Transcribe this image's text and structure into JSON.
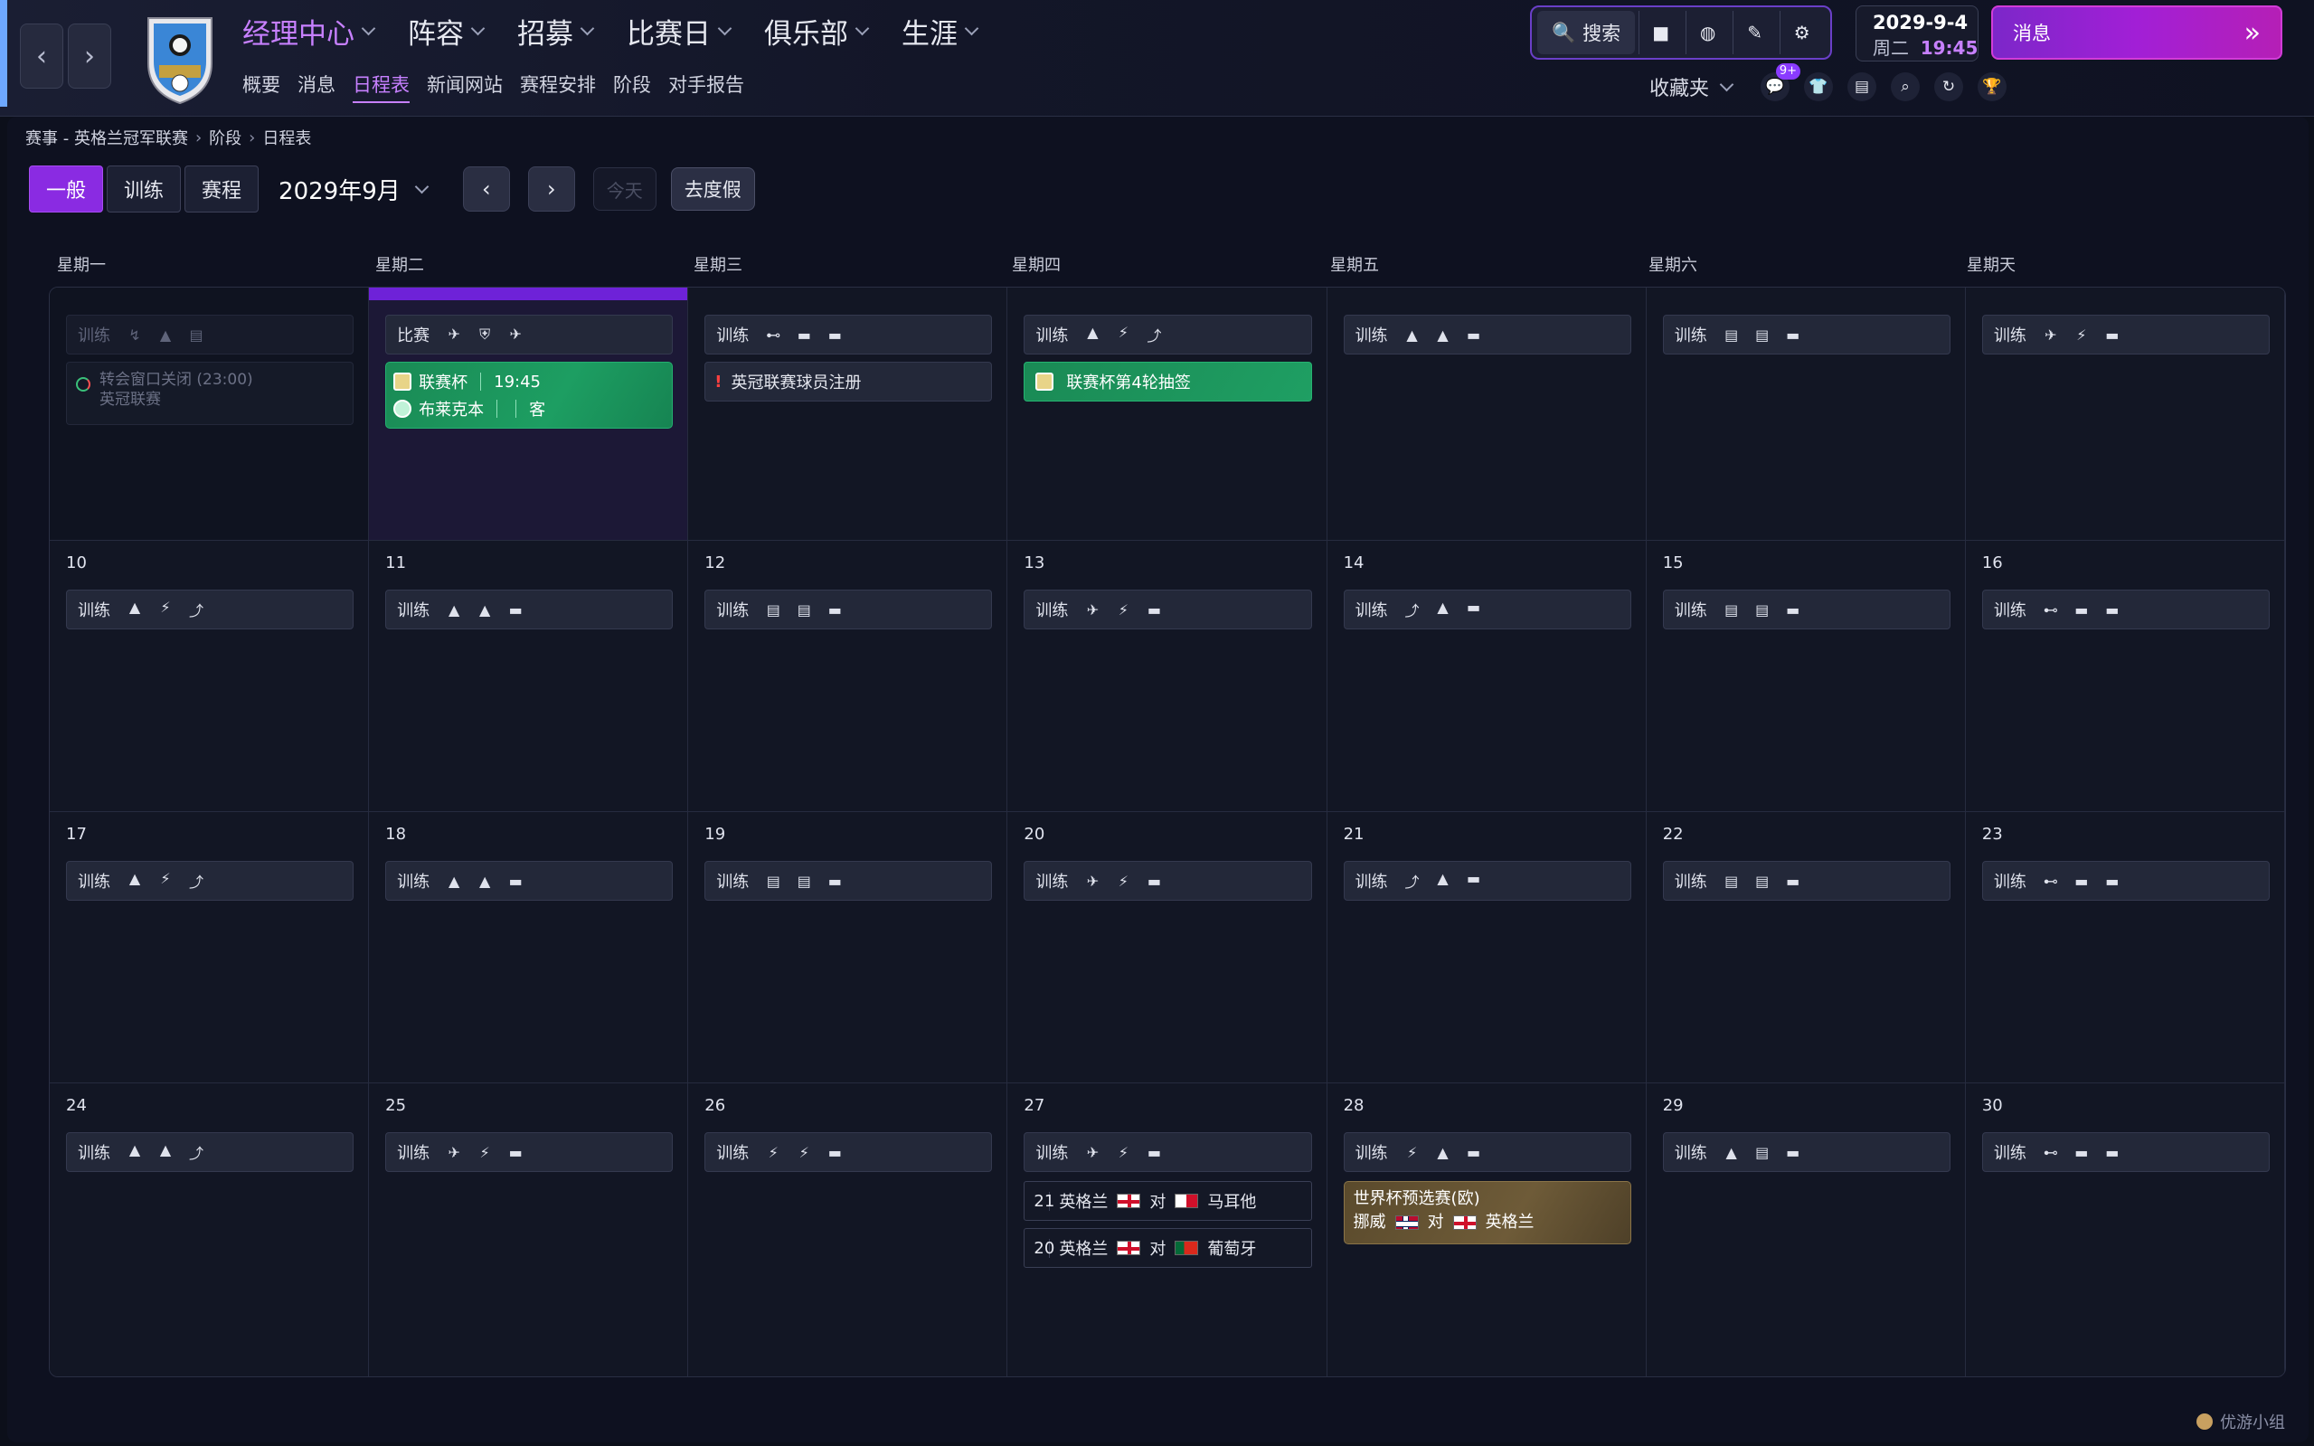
{
  "nav": {
    "back_icon": "‹",
    "forward_icon": "›"
  },
  "menu": [
    {
      "label": "经理中心",
      "active": true
    },
    {
      "label": "阵容"
    },
    {
      "label": "招募"
    },
    {
      "label": "比赛日"
    },
    {
      "label": "俱乐部"
    },
    {
      "label": "生涯"
    }
  ],
  "submenu": [
    {
      "label": "概要"
    },
    {
      "label": "消息"
    },
    {
      "label": "日程表",
      "active": true
    },
    {
      "label": "新闻网站"
    },
    {
      "label": "赛程安排"
    },
    {
      "label": "阶段"
    },
    {
      "label": "对手报告"
    }
  ],
  "tools": {
    "search_label": "搜索"
  },
  "datetime": {
    "date": "2029-9-4",
    "weekday": "周二",
    "time": "19:45"
  },
  "messages": {
    "label": "消息"
  },
  "favorites": {
    "label": "收藏夹",
    "badge": "9+"
  },
  "breadcrumb": {
    "part1": "赛事 - 英格兰冠军联赛",
    "part2": "阶段",
    "part3": "日程表"
  },
  "toolbar": {
    "view_general": "一般",
    "view_training": "训练",
    "view_fixtures": "赛程",
    "month": "2029年9月",
    "today": "今天",
    "vacation": "去度假"
  },
  "weekdays": [
    "星期一",
    "星期二",
    "星期三",
    "星期四",
    "星期五",
    "星期六",
    "星期天"
  ],
  "calendar": {
    "training_label": "训练",
    "match_label": "比赛",
    "days": [
      {
        "num": "10"
      },
      {
        "num": "11"
      },
      {
        "num": "12"
      },
      {
        "num": "13"
      },
      {
        "num": "14"
      },
      {
        "num": "15"
      },
      {
        "num": "16"
      },
      {
        "num": "17"
      },
      {
        "num": "18"
      },
      {
        "num": "19"
      },
      {
        "num": "20"
      },
      {
        "num": "21"
      },
      {
        "num": "22"
      },
      {
        "num": "23"
      },
      {
        "num": "24"
      },
      {
        "num": "25"
      },
      {
        "num": "26"
      },
      {
        "num": "27"
      },
      {
        "num": "28"
      },
      {
        "num": "29"
      },
      {
        "num": "30"
      }
    ]
  },
  "events": {
    "transfer_window": "转会窗口关闭 (23:00)",
    "transfer_league": "英冠联赛",
    "cup_match_comp": "联赛杯",
    "cup_match_time": "19:45",
    "cup_match_opponent": "布莱克本",
    "cup_match_venue": "客",
    "registration": "英冠联赛球员注册",
    "cup_draw": "联赛杯第4轮抽签",
    "intl1": {
      "num": "21",
      "home": "英格兰",
      "vs": "对",
      "away": "马耳他"
    },
    "intl2": {
      "num": "20",
      "home": "英格兰",
      "vs": "对",
      "away": "葡萄牙"
    },
    "wcq": {
      "title": "世界杯预选赛(欧)",
      "home": "挪威",
      "vs": "对",
      "away": "英格兰"
    }
  },
  "watermark": "优游小组",
  "colors": {
    "accent": "#c780ff",
    "primary": "#8a2be2",
    "match_green": "#1d9e62"
  }
}
